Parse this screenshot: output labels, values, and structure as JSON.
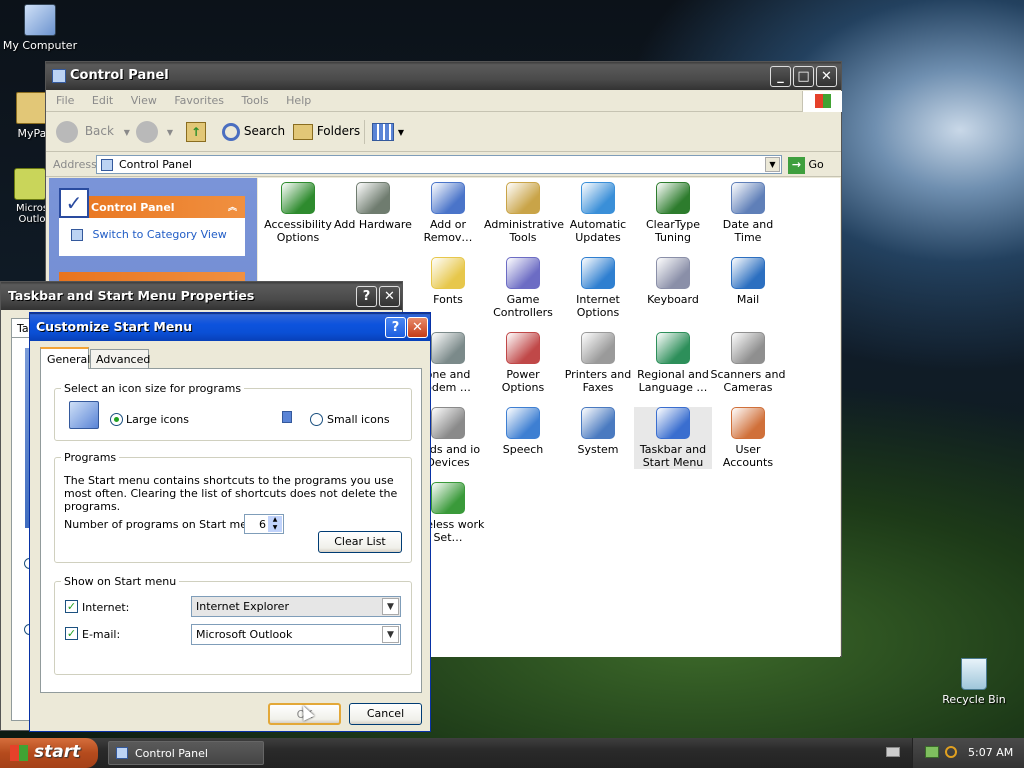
{
  "desktop": {
    "icons": [
      {
        "label": "My Computer"
      },
      {
        "label": "MyPa"
      },
      {
        "label": "Micros Outlo"
      },
      {
        "label": "Recycle Bin"
      }
    ]
  },
  "control_panel": {
    "title": "Control Panel",
    "menu": [
      "File",
      "Edit",
      "View",
      "Favorites",
      "Tools",
      "Help"
    ],
    "toolbar": {
      "back": "Back",
      "search": "Search",
      "folders": "Folders"
    },
    "address": {
      "label": "Address",
      "value": "Control Panel",
      "go": "Go"
    },
    "sidebar": {
      "header": "Control Panel",
      "link": "Switch to Category View"
    },
    "items": [
      {
        "label": "Accessibility Options",
        "icon": "accessibility-icon",
        "color": "#2e8b2e"
      },
      {
        "label": "Add Hardware",
        "icon": "hardware-icon",
        "color": "#6f7c6f"
      },
      {
        "label": "Add or Remov…",
        "icon": "add-remove-programs-icon",
        "color": "#4a74c9"
      },
      {
        "label": "Administrative Tools",
        "icon": "administrative-tools-icon",
        "color": "#c9a448"
      },
      {
        "label": "Automatic Updates",
        "icon": "windows-update-icon",
        "color": "#3a8fd8"
      },
      {
        "label": "ClearType Tuning",
        "icon": "cleartype-icon",
        "color": "#2d7c2d"
      },
      {
        "label": "Date and Time",
        "icon": "clock-icon",
        "color": "#5f7fb8"
      },
      {
        "label": "Fonts",
        "icon": "fonts-folder-icon",
        "color": "#e7c74b"
      },
      {
        "label": "Game Controllers",
        "icon": "gamepad-icon",
        "color": "#6c6cc4"
      },
      {
        "label": "Internet Options",
        "icon": "internet-options-icon",
        "color": "#2f7fd0"
      },
      {
        "label": "Keyboard",
        "icon": "keyboard-icon",
        "color": "#8a8fa8"
      },
      {
        "label": "Mail",
        "icon": "mail-icon",
        "color": "#2c6fc0"
      },
      {
        "label": "one and odem …",
        "icon": "phone-modem-icon",
        "color": "#7b8a8a"
      },
      {
        "label": "Power Options",
        "icon": "power-icon",
        "color": "#c04848"
      },
      {
        "label": "Printers and Faxes",
        "icon": "printer-icon",
        "color": "#9a9a9a"
      },
      {
        "label": "Regional and Language …",
        "icon": "globe-icon",
        "color": "#2d8f5a"
      },
      {
        "label": "Scanners and Cameras",
        "icon": "scanner-icon",
        "color": "#8f8f8f"
      },
      {
        "label": "unds and io Devices",
        "icon": "sound-icon",
        "color": "#8a8a8a"
      },
      {
        "label": "Speech",
        "icon": "speech-icon",
        "color": "#3e7fd2"
      },
      {
        "label": "System",
        "icon": "system-icon",
        "color": "#4a7ac0"
      },
      {
        "label": "Taskbar and Start Menu",
        "icon": "taskbar-icon",
        "color": "#3a6ecf"
      },
      {
        "label": "User Accounts",
        "icon": "user-accounts-icon",
        "color": "#d0703a"
      },
      {
        "label": "Vireless work Set…",
        "icon": "wireless-icon",
        "color": "#3a9a3a"
      }
    ]
  },
  "taskbar_props": {
    "title": "Taskbar and Start Menu Properties",
    "tab_partial": "Ta"
  },
  "customize": {
    "title": "Customize Start Menu",
    "tabs": [
      "General",
      "Advanced"
    ],
    "icon_size": {
      "legend": "Select an icon size for programs",
      "large": "Large icons",
      "small": "Small icons",
      "selected": "large"
    },
    "programs": {
      "legend": "Programs",
      "text": "The Start menu contains shortcuts to the programs you use most often. Clearing the list of shortcuts does not delete the programs.",
      "count_label": "Number of programs on Start menu:",
      "count": "6",
      "clear": "Clear List"
    },
    "show": {
      "legend": "Show on Start menu",
      "internet_label": "Internet:",
      "internet_value": "Internet Explorer",
      "email_label": "E-mail:",
      "email_value": "Microsoft Outlook"
    },
    "ok": "OK",
    "cancel": "Cancel"
  },
  "taskbar": {
    "start": "start",
    "task": "Control Panel",
    "clock": "5:07 AM"
  }
}
